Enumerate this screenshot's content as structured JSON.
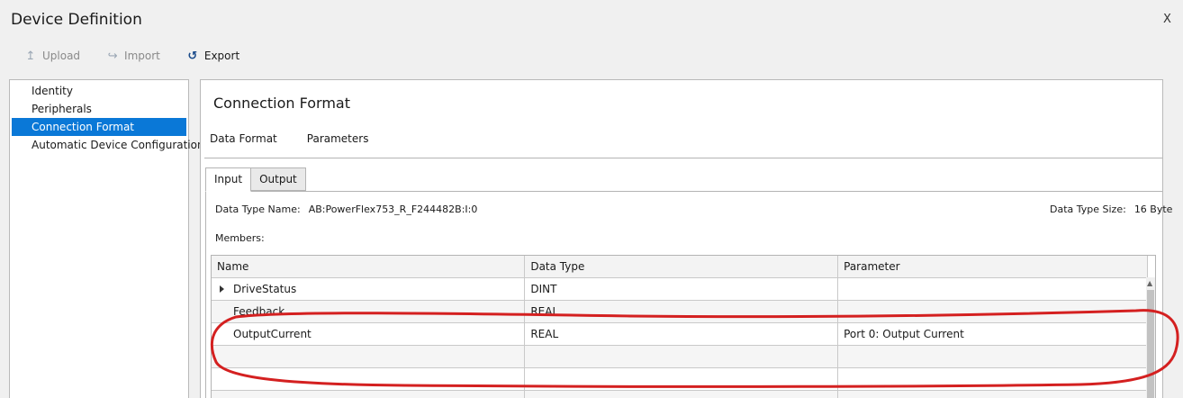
{
  "window": {
    "title": "Device Definition",
    "close_glyph": "X"
  },
  "toolbar": {
    "upload_label": "Upload",
    "import_label": "Import",
    "export_label": "Export"
  },
  "nav": {
    "items": [
      {
        "label": "Identity",
        "selected": false
      },
      {
        "label": "Peripherals",
        "selected": false
      },
      {
        "label": "Connection Format",
        "selected": true
      },
      {
        "label": "Automatic Device Configuration",
        "selected": false
      }
    ]
  },
  "main": {
    "title": "Connection Format",
    "subtabs": [
      "Data Format",
      "Parameters"
    ],
    "tabs": [
      {
        "label": "Input",
        "active": true
      },
      {
        "label": "Output",
        "active": false
      }
    ],
    "data_type_name_label": "Data Type Name:",
    "data_type_name_value": "AB:PowerFlex753_R_F244482B:I:0",
    "data_type_size_label": "Data Type Size:",
    "data_type_size_value": "16 Byte",
    "members_label": "Members:",
    "grid": {
      "columns": [
        "Name",
        "Data Type",
        "Parameter"
      ],
      "rows": [
        {
          "name": "DriveStatus",
          "data_type": "DINT",
          "parameter": "",
          "expandable": true
        },
        {
          "name": "Feedback",
          "data_type": "REAL",
          "parameter": "",
          "expandable": false
        },
        {
          "name": "OutputCurrent",
          "data_type": "REAL",
          "parameter": "Port 0: Output Current",
          "expandable": false
        },
        {
          "name": "",
          "data_type": "",
          "parameter": "",
          "expandable": false
        },
        {
          "name": "",
          "data_type": "",
          "parameter": "",
          "expandable": false
        },
        {
          "name": "",
          "data_type": "",
          "parameter": "",
          "expandable": false
        }
      ]
    }
  },
  "colors": {
    "selection": "#0a78d7",
    "annotation": "#d42020",
    "window_bg": "#f0f0f0"
  },
  "icons": {
    "upload": "upload-arrow-icon",
    "import": "import-arrow-icon",
    "export": "export-arrow-icon",
    "expander": "triangle-right-icon",
    "scroll_up": "chevron-up-icon"
  }
}
